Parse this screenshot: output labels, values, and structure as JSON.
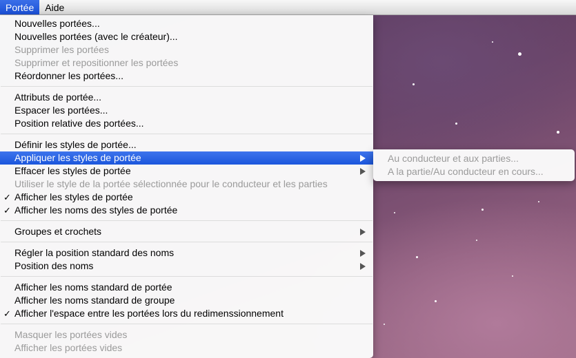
{
  "menubar": {
    "items": [
      {
        "label": "Portée"
      },
      {
        "label": "Aide"
      }
    ]
  },
  "menu": {
    "groups": [
      [
        {
          "label": "Nouvelles portées..."
        },
        {
          "label": "Nouvelles portées (avec le créateur)..."
        },
        {
          "label": "Supprimer les portées"
        },
        {
          "label": "Supprimer et repositionner les portées"
        },
        {
          "label": "Réordonner les portées..."
        }
      ],
      [
        {
          "label": "Attributs de portée..."
        },
        {
          "label": "Espacer les portées..."
        },
        {
          "label": "Position relative des portées..."
        }
      ],
      [
        {
          "label": "Définir les styles de portée..."
        },
        {
          "label": "Appliquer les styles de portée"
        },
        {
          "label": "Effacer les styles de portée"
        },
        {
          "label": "Utiliser le style de la portée sélectionnée pour le conducteur et les parties"
        },
        {
          "label": "Afficher les styles de portée"
        },
        {
          "label": "Afficher les noms des styles de portée"
        }
      ],
      [
        {
          "label": "Groupes et crochets"
        }
      ],
      [
        {
          "label": "Régler la position standard des noms"
        },
        {
          "label": "Position des noms"
        }
      ],
      [
        {
          "label": "Afficher les noms standard de portée"
        },
        {
          "label": "Afficher les noms standard de groupe"
        },
        {
          "label": "Afficher l'espace entre les portées lors du redimenssionnement"
        }
      ],
      [
        {
          "label": "Masquer les portées vides"
        },
        {
          "label": "Afficher les portées vides"
        }
      ]
    ]
  },
  "submenu": {
    "items": [
      {
        "label": "Au conducteur et aux parties..."
      },
      {
        "label": "A la partie/Au conducteur en cours..."
      }
    ]
  },
  "icons": {
    "checkmark": "✓",
    "submenu_arrow": "▶"
  },
  "colors": {
    "highlight": "#1b56dc",
    "disabled_text": "#9a9a9a"
  }
}
